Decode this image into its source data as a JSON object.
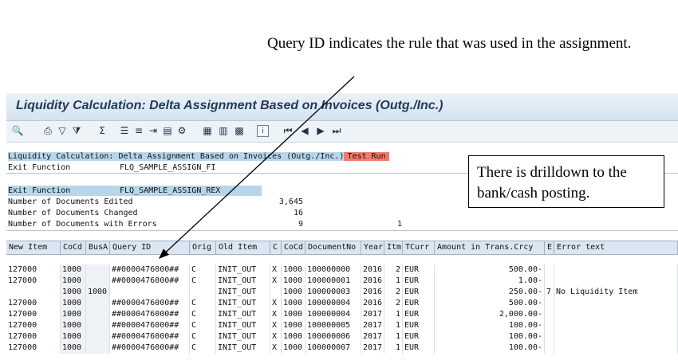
{
  "annotations": {
    "top": "Query ID indicates the rule that was used in the assignment.",
    "box": "There is drilldown to the bank/cash posting."
  },
  "window": {
    "title": "Liquidity Calculation: Delta Assignment Based on Invoices (Outg./Inc.)"
  },
  "toolbar": {
    "icons": [
      "search-icon",
      "print-icon",
      "filter-icon",
      "filter-set-icon",
      "sum-icon",
      "subtotal-icon",
      "graphic-icon",
      "export-icon",
      "layout-icon",
      "settings-icon",
      "grid-icon",
      "grid-columns-icon",
      "grid-select-icon",
      "info-icon",
      "first-page-icon",
      "previous-page-icon",
      "next-page-icon",
      "last-page-icon"
    ]
  },
  "header": {
    "program_title": "Liquidity Calculation: Delta Assignment Based on Invoices (Outg./Inc.)",
    "mode": "Test Run",
    "exit_function_label_1": "Exit Function",
    "exit_function_value_1": "FLQ_SAMPLE_ASSIGN_FI",
    "exit_function_label_2": "Exit Function",
    "exit_function_value_2": "FLQ_SAMPLE_ASSIGN_REX",
    "stats": [
      {
        "label": "Number of Documents Edited",
        "value": "3,645"
      },
      {
        "label": "Number of Documents Changed",
        "value": "16"
      },
      {
        "label": "Number of Documents with Errors",
        "value": "9",
        "extra": "1"
      }
    ]
  },
  "table": {
    "columns": [
      "New Item",
      "CoCd",
      "BusA",
      "Query ID",
      "Orig",
      "Old Item",
      "C",
      "CoCd",
      "DocumentNo",
      "Year",
      "Itm",
      "TCurr",
      "Amount in Trans.Crcy",
      "E",
      "Error text"
    ],
    "rows": [
      [
        "127000",
        "1000",
        "",
        "##0000476000##",
        "C",
        "INIT_OUT",
        "X",
        "1000",
        "100000000",
        "2016",
        "2",
        "EUR",
        "500.00-",
        "",
        ""
      ],
      [
        "127000",
        "1000",
        "",
        "##0000476000##",
        "C",
        "INIT_OUT",
        "X",
        "1000",
        "100000001",
        "2016",
        "1",
        "EUR",
        "1.00-",
        "",
        ""
      ],
      [
        "",
        "1000",
        "1000",
        "",
        "",
        "INIT_OUT",
        "",
        "1000",
        "100000003",
        "2016",
        "2",
        "EUR",
        "250.00-",
        "7",
        "No Liquidity Item"
      ],
      [
        "127000",
        "1000",
        "",
        "##0000476000##",
        "C",
        "INIT_OUT",
        "X",
        "1000",
        "100000004",
        "2016",
        "2",
        "EUR",
        "500.00-",
        "",
        ""
      ],
      [
        "127000",
        "1000",
        "",
        "##0000476000##",
        "C",
        "INIT_OUT",
        "X",
        "1000",
        "100000004",
        "2017",
        "1",
        "EUR",
        "2,000.00-",
        "",
        ""
      ],
      [
        "127000",
        "1000",
        "",
        "##0000476000##",
        "C",
        "INIT_OUT",
        "X",
        "1000",
        "100000005",
        "2017",
        "1",
        "EUR",
        "100.00-",
        "",
        ""
      ],
      [
        "127000",
        "1000",
        "",
        "##0000476000##",
        "C",
        "INIT_OUT",
        "X",
        "1000",
        "100000006",
        "2017",
        "1",
        "EUR",
        "100.00-",
        "",
        ""
      ],
      [
        "127000",
        "1000",
        "",
        "##0000476000##",
        "C",
        "INIT_OUT",
        "X",
        "1000",
        "100000007",
        "2017",
        "1",
        "EUR",
        "100.00-",
        "",
        ""
      ]
    ]
  }
}
